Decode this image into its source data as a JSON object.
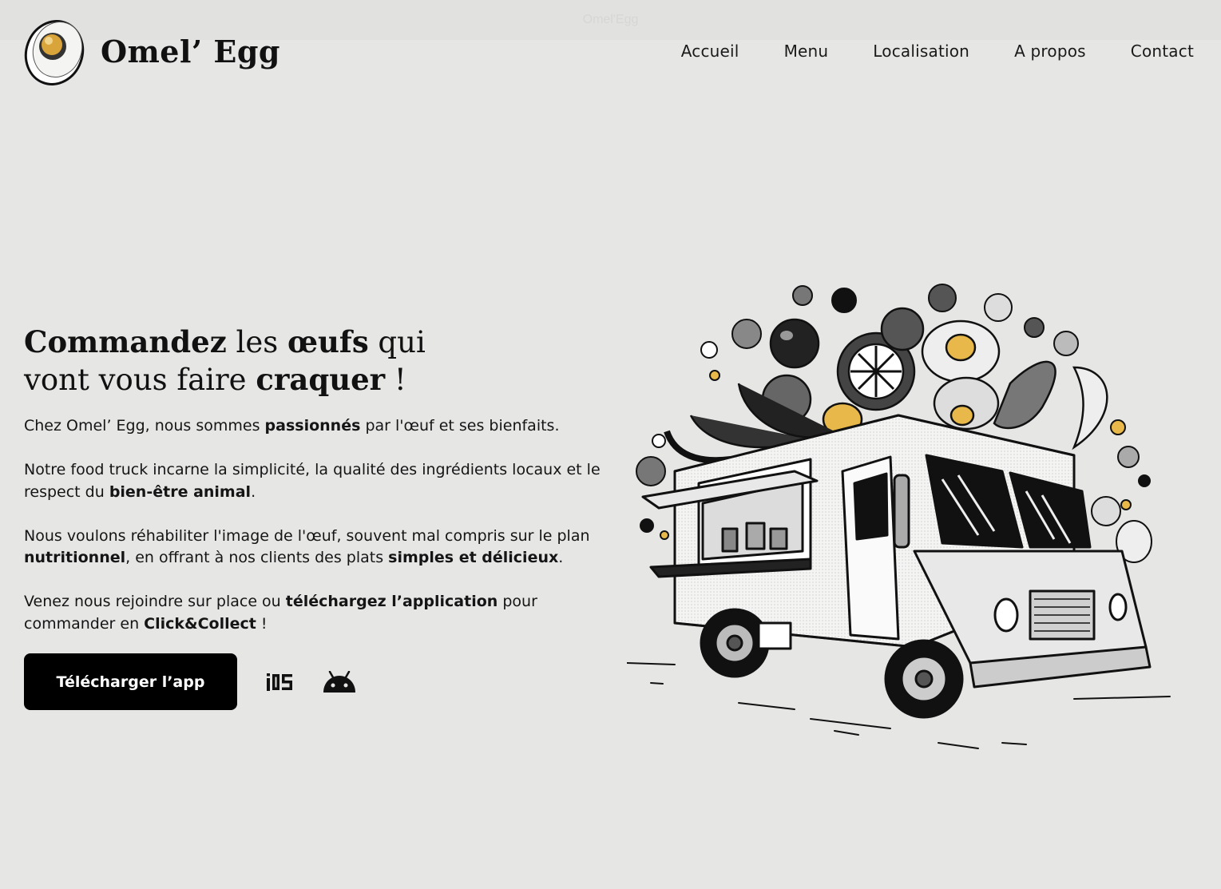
{
  "top_banner": {
    "text": "Omel'Egg"
  },
  "header": {
    "brand": "Omel’ Egg",
    "logo_icon": "egg-logo-icon",
    "nav": [
      "Accueil",
      "Menu",
      "Localisation",
      "A propos",
      "Contact"
    ]
  },
  "hero": {
    "title": {
      "w1": "Commandez",
      "w2": " les ",
      "w3": "œufs",
      "w4": " qui",
      "w5": "vont vous faire ",
      "w6": "craquer",
      "w7": " !"
    },
    "p1": {
      "a": "Chez Omel’ Egg, nous sommes ",
      "b": "passionnés",
      "c": " par l'œuf et ses bienfaits."
    },
    "p2": {
      "a": "Notre food truck incarne la simplicité, la qualité des ingrédients locaux et le respect du ",
      "b": "bien-être animal",
      "c": "."
    },
    "p3": {
      "a": "Nous voulons réhabiliter l'image de l'œuf, souvent mal compris sur le plan ",
      "b": "nutritionnel",
      "c": ", en offrant à nos clients des plats ",
      "d": "simples et délicieux",
      "e": "."
    },
    "p4": {
      "a": "Venez nous rejoindre sur place ou ",
      "b": "téléchargez l’application",
      "c": " pour commander en ",
      "d": "Click&Collect",
      "e": " !"
    },
    "cta_label": "Télécharger l’app",
    "ios_label": "iOS",
    "icons": [
      "ios-icon",
      "android-icon",
      "food-truck-illustration"
    ]
  },
  "colors": {
    "background": "#e6e6e5",
    "button": "#000000",
    "egg_yolk": "#e8b84a"
  }
}
